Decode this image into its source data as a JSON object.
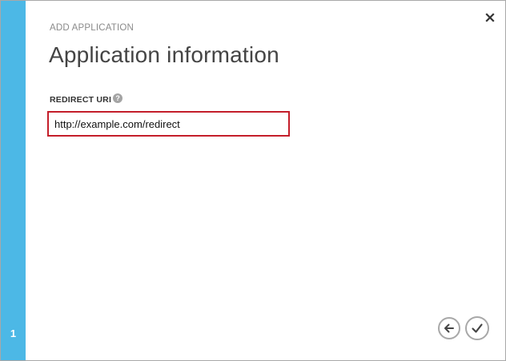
{
  "wizard": {
    "header_label": "ADD APPLICATION",
    "title": "Application information",
    "step_number": "1"
  },
  "form": {
    "redirect_uri_label": "REDIRECT URI",
    "help_glyph": "?",
    "redirect_uri_value": "http://example.com/redirect"
  },
  "icons": {
    "close": "close-icon",
    "help": "help-icon",
    "back": "arrow-left-icon",
    "complete": "checkmark-icon"
  },
  "colors": {
    "accent_bar": "#4cb8e6",
    "input_border_highlight": "#c41e2a",
    "nav_button_border": "#a8a8a8"
  }
}
